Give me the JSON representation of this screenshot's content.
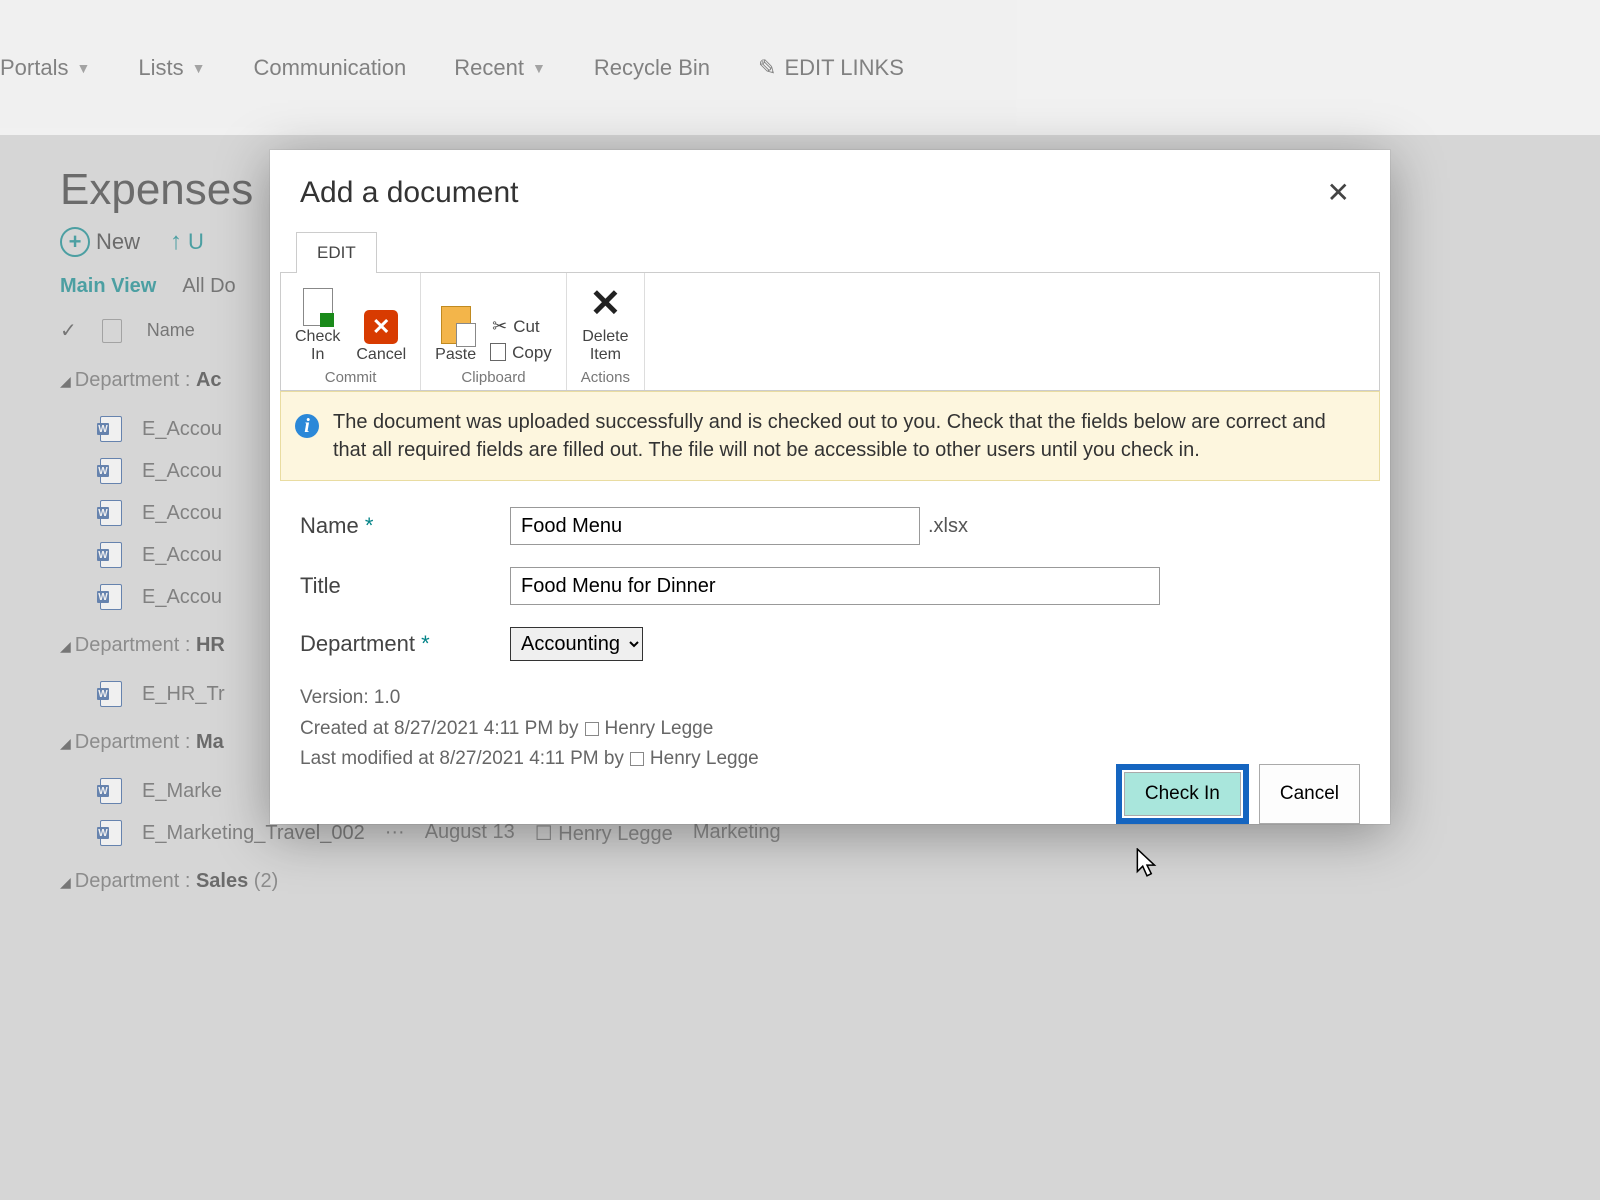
{
  "topnav": {
    "portals": "Portals",
    "lists": "Lists",
    "communication": "Communication",
    "recent": "Recent",
    "recycle": "Recycle Bin",
    "editlinks": "EDIT LINKS"
  },
  "page_title": "Expenses",
  "actions": {
    "new": "New",
    "upload": "U"
  },
  "views": {
    "main": "Main View",
    "all": "All Do"
  },
  "cols": {
    "name": "Name"
  },
  "groups": [
    {
      "label": "Department :",
      "value": "Ac",
      "items": [
        "E_Accou",
        "E_Accou",
        "E_Accou",
        "E_Accou",
        "E_Accou"
      ]
    },
    {
      "label": "Department :",
      "value": "HR",
      "items": [
        "E_HR_Tr"
      ]
    },
    {
      "label": "Department :",
      "value": "Ma",
      "items": [
        "E_Marke",
        "E_Marketing_Travel_002"
      ]
    },
    {
      "label": "Department :",
      "value": "Sales",
      "count": "(2)",
      "items": []
    }
  ],
  "row_extra": {
    "dots": "···",
    "date": "August 13",
    "user": "Henry Legge",
    "dept": "Marketing"
  },
  "modal": {
    "title": "Add a document",
    "tab": "EDIT",
    "ribbon": {
      "checkin": "Check\nIn",
      "cancel": "Cancel",
      "paste": "Paste",
      "cut": "Cut",
      "copy": "Copy",
      "delete": "Delete\nItem",
      "g_commit": "Commit",
      "g_clipboard": "Clipboard",
      "g_actions": "Actions"
    },
    "info": "The document was uploaded successfully and is checked out to you. Check that the fields below are correct and that all required fields are filled out. The file will not be accessible to other users until you check in.",
    "labels": {
      "name": "Name",
      "title": "Title",
      "department": "Department"
    },
    "values": {
      "name": "Food Menu",
      "ext": ".xlsx",
      "title": "Food Menu for Dinner",
      "department": "Accounting"
    },
    "version": "Version: 1.0",
    "created": "Created at 8/27/2021 4:11 PM  by",
    "created_user": "Henry Legge",
    "modified": "Last modified at 8/27/2021 4:11 PM  by",
    "modified_user": "Henry Legge",
    "btn_checkin": "Check In",
    "btn_cancel": "Cancel"
  }
}
